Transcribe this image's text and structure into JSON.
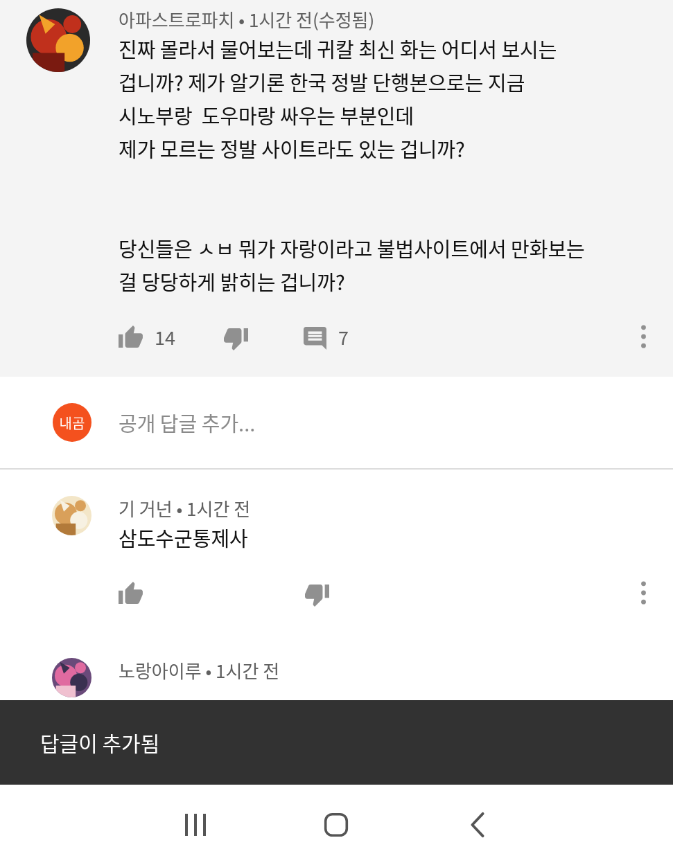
{
  "comments": [
    {
      "highlighted": true,
      "meta": "아파스트로파치 • 1시간 전(수정됨)",
      "body": "진짜 몰라서 물어보는데 귀칼 최신 화는 어디서 보시는\n겁니까? 제가 알기론 한국 정발 단행본으로는 지금\n시노부랑  도우마랑 싸우는 부분인데\n제가 모르는 정발 사이트라도 있는 겁니까?\n\n\n당신들은 ㅅㅂ 뭐가 자랑이라고 불법사이트에서 만화보는\n걸 당당하게 밝히는 겁니까?",
      "likes": "14",
      "replies": "7",
      "menu": true
    },
    {
      "highlighted": false,
      "meta": "기 거넌 • 1시간 전",
      "body": "삼도수군통제사",
      "menu": true
    },
    {
      "highlighted": false,
      "meta": "노랑아이루 • 1시간 전",
      "menu": false
    }
  ],
  "reply_box": {
    "avatar_text": "내곰",
    "placeholder": "공개 답글 추가..."
  },
  "snackbar": "답글이 추가됨"
}
